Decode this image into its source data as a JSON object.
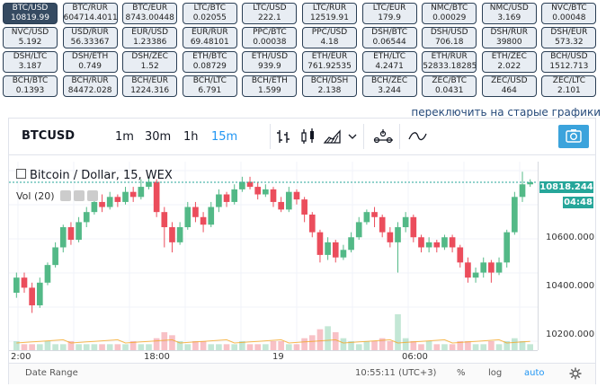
{
  "pairs": [
    {
      "name": "BTC/USD",
      "value": "10819.99",
      "active": true
    },
    {
      "name": "BTC/RUR",
      "value": "604714.4011"
    },
    {
      "name": "BTC/EUR",
      "value": "8743.00448"
    },
    {
      "name": "LTC/BTC",
      "value": "0.02055"
    },
    {
      "name": "LTC/USD",
      "value": "222.1"
    },
    {
      "name": "LTC/RUR",
      "value": "12519.91"
    },
    {
      "name": "LTC/EUR",
      "value": "179.9"
    },
    {
      "name": "NMC/BTC",
      "value": "0.00029"
    },
    {
      "name": "NMC/USD",
      "value": "3.169"
    },
    {
      "name": "NVC/BTC",
      "value": "0.00048"
    },
    {
      "name": "NVC/USD",
      "value": "5.192"
    },
    {
      "name": "USD/RUR",
      "value": "56.33367"
    },
    {
      "name": "EUR/USD",
      "value": "1.23386"
    },
    {
      "name": "EUR/RUR",
      "value": "69.48101"
    },
    {
      "name": "PPC/BTC",
      "value": "0.00038"
    },
    {
      "name": "PPC/USD",
      "value": "4.18"
    },
    {
      "name": "DSH/BTC",
      "value": "0.06544"
    },
    {
      "name": "DSH/USD",
      "value": "706.18"
    },
    {
      "name": "DSH/RUR",
      "value": "39800"
    },
    {
      "name": "DSH/EUR",
      "value": "573.32"
    },
    {
      "name": "DSH/LTC",
      "value": "3.187"
    },
    {
      "name": "DSH/ETH",
      "value": "0.749"
    },
    {
      "name": "DSH/ZEC",
      "value": "1.52"
    },
    {
      "name": "ETH/BTC",
      "value": "0.08729"
    },
    {
      "name": "ETH/USD",
      "value": "939.9"
    },
    {
      "name": "ETH/EUR",
      "value": "761.92535"
    },
    {
      "name": "ETH/LTC",
      "value": "4.2471"
    },
    {
      "name": "ETH/RUR",
      "value": "52833.18285"
    },
    {
      "name": "ETH/ZEC",
      "value": "2.022"
    },
    {
      "name": "BCH/USD",
      "value": "1512.713"
    },
    {
      "name": "BCH/BTC",
      "value": "0.1393"
    },
    {
      "name": "BCH/RUR",
      "value": "84472.028"
    },
    {
      "name": "BCH/EUR",
      "value": "1224.316"
    },
    {
      "name": "BCH/LTC",
      "value": "6.791"
    },
    {
      "name": "BCH/ETH",
      "value": "1.599"
    },
    {
      "name": "BCH/DSH",
      "value": "2.138"
    },
    {
      "name": "BCH/ZEC",
      "value": "3.244"
    },
    {
      "name": "ZEC/BTC",
      "value": "0.0431"
    },
    {
      "name": "ZEC/USD",
      "value": "464"
    },
    {
      "name": "ZEC/LTC",
      "value": "2.101"
    }
  ],
  "switch_link": "переключить на старые графики",
  "toolbar": {
    "symbol": "BTCUSD",
    "timeframes": [
      {
        "label": "1m",
        "selected": false
      },
      {
        "label": "30m",
        "selected": false
      },
      {
        "label": "1h",
        "selected": false
      },
      {
        "label": "15m",
        "selected": true
      }
    ],
    "icons": [
      "bar-chart-icon",
      "candle-chart-icon",
      "area-chart-icon",
      "chevron-down-icon",
      "indicators-icon",
      "compare-icon"
    ],
    "camera_icon": "camera-icon"
  },
  "legend": {
    "title": "Bitcoin / Dollar, 15, WEX",
    "volume": "Vol (20)"
  },
  "axis": {
    "price_labels": [
      "10600.000",
      "10400.000",
      "10200.000"
    ],
    "last_price": "10818.244",
    "countdown": "04:48",
    "time_labels": [
      "2:00",
      "18:00",
      "19",
      "06:00"
    ]
  },
  "footer": {
    "date_range": "Date Range",
    "clock": "10:55:11 (UTC+3)",
    "percent": "%",
    "log": "log",
    "auto": "auto",
    "settings_icon": "gear-icon"
  },
  "colors": {
    "up": "#53b987",
    "down": "#eb4d5c",
    "accent": "#2196f3",
    "last_price": "#26a69a"
  },
  "chart_data": {
    "type": "candlestick",
    "title": "Bitcoin / Dollar, 15, WEX",
    "ylim": [
      10170,
      10900
    ],
    "x_ticks": [
      "2:00",
      "18:00",
      "19",
      "06:00"
    ],
    "candles": [
      {
        "o": 10380,
        "c": 10440,
        "h": 10460,
        "l": 10360
      },
      {
        "o": 10440,
        "c": 10400,
        "h": 10460,
        "l": 10380
      },
      {
        "o": 10400,
        "c": 10330,
        "h": 10420,
        "l": 10300
      },
      {
        "o": 10330,
        "c": 10420,
        "h": 10440,
        "l": 10320
      },
      {
        "o": 10420,
        "c": 10490,
        "h": 10500,
        "l": 10410
      },
      {
        "o": 10490,
        "c": 10560,
        "h": 10580,
        "l": 10480
      },
      {
        "o": 10560,
        "c": 10640,
        "h": 10650,
        "l": 10540
      },
      {
        "o": 10640,
        "c": 10590,
        "h": 10660,
        "l": 10570
      },
      {
        "o": 10590,
        "c": 10660,
        "h": 10680,
        "l": 10580
      },
      {
        "o": 10660,
        "c": 10700,
        "h": 10720,
        "l": 10640
      },
      {
        "o": 10700,
        "c": 10740,
        "h": 10760,
        "l": 10690
      },
      {
        "o": 10740,
        "c": 10720,
        "h": 10770,
        "l": 10700
      },
      {
        "o": 10720,
        "c": 10760,
        "h": 10780,
        "l": 10710
      },
      {
        "o": 10760,
        "c": 10740,
        "h": 10770,
        "l": 10720
      },
      {
        "o": 10740,
        "c": 10780,
        "h": 10800,
        "l": 10730
      },
      {
        "o": 10780,
        "c": 10760,
        "h": 10800,
        "l": 10740
      },
      {
        "o": 10760,
        "c": 10800,
        "h": 10830,
        "l": 10750
      },
      {
        "o": 10800,
        "c": 10820,
        "h": 10840,
        "l": 10790
      },
      {
        "o": 10820,
        "c": 10700,
        "h": 10830,
        "l": 10680
      },
      {
        "o": 10700,
        "c": 10640,
        "h": 10720,
        "l": 10560
      },
      {
        "o": 10640,
        "c": 10580,
        "h": 10660,
        "l": 10540
      },
      {
        "o": 10580,
        "c": 10640,
        "h": 10660,
        "l": 10570
      },
      {
        "o": 10640,
        "c": 10720,
        "h": 10740,
        "l": 10630
      },
      {
        "o": 10720,
        "c": 10680,
        "h": 10740,
        "l": 10660
      },
      {
        "o": 10680,
        "c": 10650,
        "h": 10700,
        "l": 10620
      },
      {
        "o": 10650,
        "c": 10720,
        "h": 10740,
        "l": 10640
      },
      {
        "o": 10720,
        "c": 10770,
        "h": 10790,
        "l": 10700
      },
      {
        "o": 10770,
        "c": 10740,
        "h": 10780,
        "l": 10720
      },
      {
        "o": 10740,
        "c": 10790,
        "h": 10810,
        "l": 10730
      },
      {
        "o": 10790,
        "c": 10820,
        "h": 10840,
        "l": 10780
      },
      {
        "o": 10820,
        "c": 10800,
        "h": 10840,
        "l": 10790
      },
      {
        "o": 10800,
        "c": 10770,
        "h": 10820,
        "l": 10750
      },
      {
        "o": 10770,
        "c": 10790,
        "h": 10810,
        "l": 10760
      },
      {
        "o": 10790,
        "c": 10740,
        "h": 10800,
        "l": 10720
      },
      {
        "o": 10740,
        "c": 10710,
        "h": 10760,
        "l": 10700
      },
      {
        "o": 10710,
        "c": 10780,
        "h": 10800,
        "l": 10700
      },
      {
        "o": 10780,
        "c": 10750,
        "h": 10790,
        "l": 10730
      },
      {
        "o": 10750,
        "c": 10690,
        "h": 10760,
        "l": 10660
      },
      {
        "o": 10690,
        "c": 10620,
        "h": 10700,
        "l": 10600
      },
      {
        "o": 10620,
        "c": 10530,
        "h": 10630,
        "l": 10500
      },
      {
        "o": 10530,
        "c": 10580,
        "h": 10600,
        "l": 10510
      },
      {
        "o": 10580,
        "c": 10520,
        "h": 10590,
        "l": 10500
      },
      {
        "o": 10520,
        "c": 10550,
        "h": 10570,
        "l": 10510
      },
      {
        "o": 10550,
        "c": 10600,
        "h": 10620,
        "l": 10540
      },
      {
        "o": 10600,
        "c": 10660,
        "h": 10680,
        "l": 10590
      },
      {
        "o": 10660,
        "c": 10700,
        "h": 10710,
        "l": 10650
      },
      {
        "o": 10700,
        "c": 10680,
        "h": 10720,
        "l": 10640
      },
      {
        "o": 10680,
        "c": 10620,
        "h": 10690,
        "l": 10600
      },
      {
        "o": 10620,
        "c": 10580,
        "h": 10640,
        "l": 10560
      },
      {
        "o": 10580,
        "c": 10640,
        "h": 10660,
        "l": 10460
      },
      {
        "o": 10640,
        "c": 10680,
        "h": 10700,
        "l": 10620
      },
      {
        "o": 10680,
        "c": 10600,
        "h": 10690,
        "l": 10580
      },
      {
        "o": 10600,
        "c": 10560,
        "h": 10610,
        "l": 10540
      },
      {
        "o": 10560,
        "c": 10580,
        "h": 10600,
        "l": 10540
      },
      {
        "o": 10580,
        "c": 10560,
        "h": 10590,
        "l": 10540
      },
      {
        "o": 10560,
        "c": 10600,
        "h": 10610,
        "l": 10550
      },
      {
        "o": 10600,
        "c": 10560,
        "h": 10610,
        "l": 10540
      },
      {
        "o": 10560,
        "c": 10500,
        "h": 10570,
        "l": 10480
      },
      {
        "o": 10500,
        "c": 10440,
        "h": 10520,
        "l": 10420
      },
      {
        "o": 10440,
        "c": 10460,
        "h": 10480,
        "l": 10420
      },
      {
        "o": 10460,
        "c": 10500,
        "h": 10520,
        "l": 10440
      },
      {
        "o": 10500,
        "c": 10460,
        "h": 10510,
        "l": 10420
      },
      {
        "o": 10460,
        "c": 10500,
        "h": 10520,
        "l": 10450
      },
      {
        "o": 10500,
        "c": 10620,
        "h": 10630,
        "l": 10480
      },
      {
        "o": 10620,
        "c": 10760,
        "h": 10780,
        "l": 10610
      },
      {
        "o": 10760,
        "c": 10810,
        "h": 10860,
        "l": 10740
      },
      {
        "o": 10810,
        "c": 10818,
        "h": 10830,
        "l": 10800
      }
    ],
    "volumes": [
      3,
      2,
      2,
      2,
      3,
      2,
      2,
      3,
      2,
      2,
      2,
      2,
      2,
      2,
      2,
      3,
      2,
      2,
      4,
      6,
      5,
      3,
      2,
      3,
      3,
      2,
      2,
      2,
      2,
      3,
      2,
      2,
      2,
      3,
      3,
      2,
      2,
      4,
      5,
      7,
      8,
      6,
      4,
      3,
      2,
      3,
      3,
      4,
      3,
      12,
      4,
      3,
      2,
      3,
      2,
      2,
      2,
      3,
      3,
      2,
      2,
      3,
      2,
      3,
      4,
      3,
      2
    ]
  }
}
